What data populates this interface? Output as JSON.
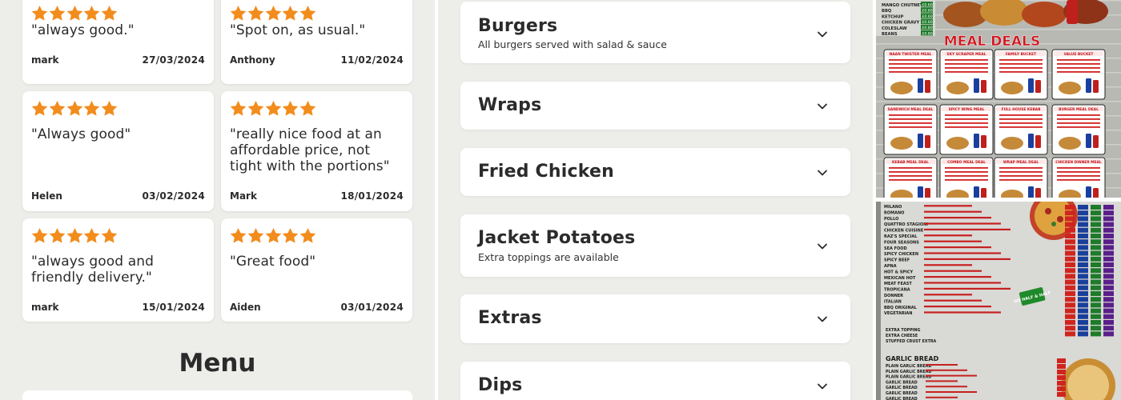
{
  "colors": {
    "star": "#f28c1c",
    "panel_bg": "#ededea",
    "card_bg": "#ffffff",
    "text": "#2b2b2b"
  },
  "reviews": [
    {
      "rating": 5,
      "text": "\"always good.\"",
      "author": "mark",
      "date": "27/03/2024"
    },
    {
      "rating": 5,
      "text": "\"Spot on, as usual.\"",
      "author": "Anthony",
      "date": "11/02/2024"
    },
    {
      "rating": 5,
      "text": "\"Always good\"",
      "author": "Helen",
      "date": "03/02/2024"
    },
    {
      "rating": 5,
      "text": "\"really nice food at an affordable price, not tight with the portions\"",
      "author": "Mark",
      "date": "18/01/2024"
    },
    {
      "rating": 5,
      "text": "\"always good and friendly delivery.\"",
      "author": "mark",
      "date": "15/01/2024"
    },
    {
      "rating": 5,
      "text": "\"Great food\"",
      "author": "Aiden",
      "date": "03/01/2024"
    }
  ],
  "menu": {
    "title": "Menu",
    "categories": [
      {
        "name": "Burgers",
        "subtitle": "All burgers served with salad & sauce",
        "icon": "chevron-down-icon"
      },
      {
        "name": "Wraps",
        "subtitle": "",
        "icon": "chevron-down-icon"
      },
      {
        "name": "Fried Chicken",
        "subtitle": "",
        "icon": "chevron-down-icon"
      },
      {
        "name": "Jacket Potatoes",
        "subtitle": "Extra toppings are available",
        "icon": "chevron-down-icon"
      },
      {
        "name": "Extras",
        "subtitle": "",
        "icon": "chevron-down-icon"
      },
      {
        "name": "Dips",
        "subtitle": "",
        "icon": "chevron-down-icon"
      }
    ]
  },
  "photos": {
    "top": {
      "heading": "MEAL DEALS",
      "side_list": [
        "MANGO CHUTNEY",
        "BBQ",
        "KETCHUP",
        "CHICKEN GRAVY",
        "COLESLAW",
        "BEANS"
      ],
      "side_prices": [
        "£0.60",
        "£0.60",
        "£0.60",
        "£0.60",
        "£0.80",
        "£0.80"
      ],
      "deals": [
        "NAAN TWISTER MEAL",
        "SKY SCRAPER MEAL",
        "FAMILY BUCKET",
        "VALUE BUCKET",
        "SANDWICH MEAL DEAL",
        "SPICY WING MEAL",
        "FULL HOUSE KEBAB",
        "BURGER MEAL DEAL",
        "KEBAB MEAL DEAL",
        "COMBO MEAL DEAL",
        "WRAP MEAL DEAL",
        "CHICKEN DINNER MEAL"
      ]
    },
    "bottom": {
      "pizzas": [
        "MILANO",
        "ROMANO",
        "POLLO",
        "QUATTRO STAGIONI",
        "CHICKEN CUISINE",
        "RAZ'S SPECIAL",
        "FOUR SEASONS",
        "SEA FOOD",
        "SPICY CHICKEN",
        "SPICY BEEF",
        "APNA",
        "HOT & SPICY",
        "MEXICAN HOT",
        "MEAT FEAST",
        "TROPICANA",
        "DONNER",
        "ITALIAN",
        "BBQ ORIGINAL",
        "VEGETARIAN"
      ],
      "extras": [
        "EXTRA TOPPING",
        "EXTRA CHEESE",
        "STUFFED CRUST EXTRA"
      ],
      "badge": "GO HALF & HALF",
      "garlic_heading": "GARLIC BREAD",
      "garlic_items": [
        "PLAIN GARLIC BREAD",
        "PLAIN GARLIC BREAD",
        "PLAIN GARLIC BREAD",
        "GARLIC BREAD",
        "GARLIC BREAD",
        "GARLIC BREAD",
        "GARLIC BREAD"
      ]
    }
  }
}
